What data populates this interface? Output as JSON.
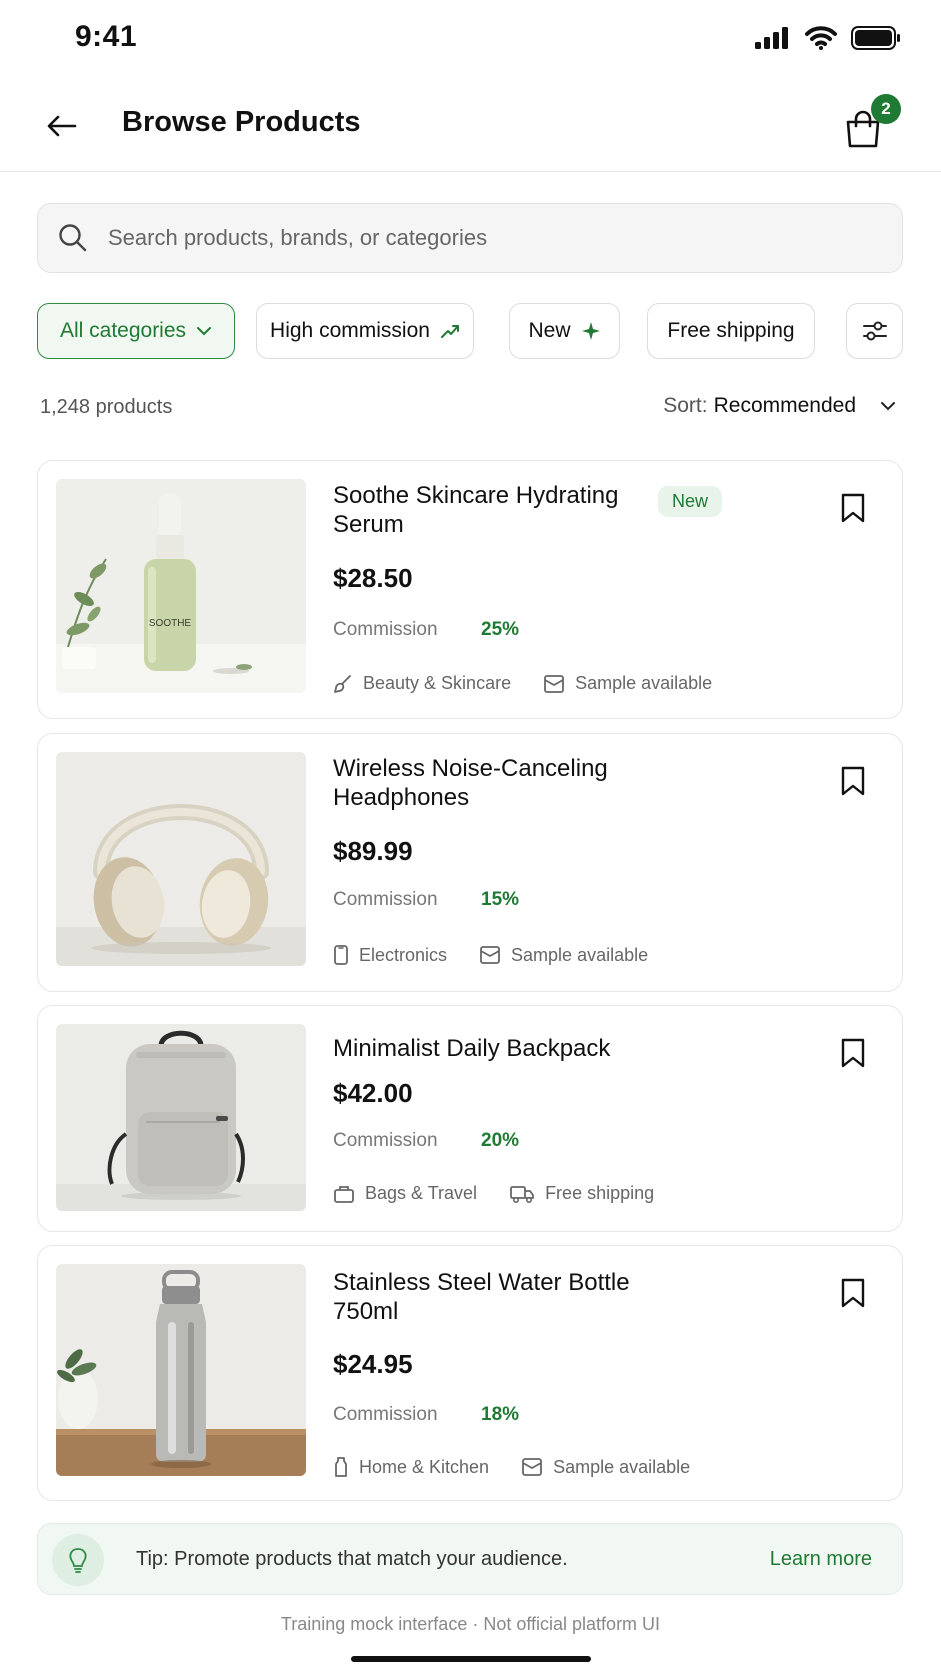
{
  "status": {
    "time": "9:41"
  },
  "header": {
    "title": "Browse Products",
    "cart_count": "2"
  },
  "search": {
    "placeholder": "Search products, brands, or categories"
  },
  "filters": {
    "all_categories": "All categories",
    "high_commission": "High commission",
    "new": "New",
    "free_shipping": "Free shipping"
  },
  "results": {
    "count": "1,248 products",
    "sort_label": "Sort:",
    "sort_value": "Recommended"
  },
  "products": [
    {
      "name": "Soothe Skincare Hydrating Serum",
      "badge": "New",
      "price": "$28.50",
      "commission_label": "Commission",
      "commission": "25%",
      "category": "Beauty & Skincare",
      "extra": "Sample available",
      "image_text": "SOOTHE"
    },
    {
      "name": "Wireless Noise-Canceling Headphones",
      "price": "$89.99",
      "commission_label": "Commission",
      "commission": "15%",
      "category": "Electronics",
      "extra": "Sample available"
    },
    {
      "name": "Minimalist Daily Backpack",
      "price": "$42.00",
      "commission_label": "Commission",
      "commission": "20%",
      "category": "Bags & Travel",
      "extra": "Free shipping"
    },
    {
      "name": "Stainless Steel Water Bottle 750ml",
      "price": "$24.95",
      "commission_label": "Commission",
      "commission": "18%",
      "category": "Home & Kitchen",
      "extra": "Sample available"
    }
  ],
  "tip": {
    "text": "Tip: Promote products that match your audience.",
    "link": "Learn more"
  },
  "footnote": "Training mock interface · Not official platform UI",
  "colors": {
    "accent": "#1f7a33",
    "chip_active_bg": "#f1f8f1"
  },
  "icons": [
    "back-arrow-icon",
    "shopping-bag-icon",
    "search-icon",
    "chevron-down-icon",
    "trending-up-icon",
    "sparkle-icon",
    "sliders-icon",
    "bookmark-icon",
    "brush-icon",
    "package-icon",
    "phone-icon",
    "bag-icon",
    "truck-icon",
    "bottle-icon",
    "lightbulb-icon"
  ]
}
